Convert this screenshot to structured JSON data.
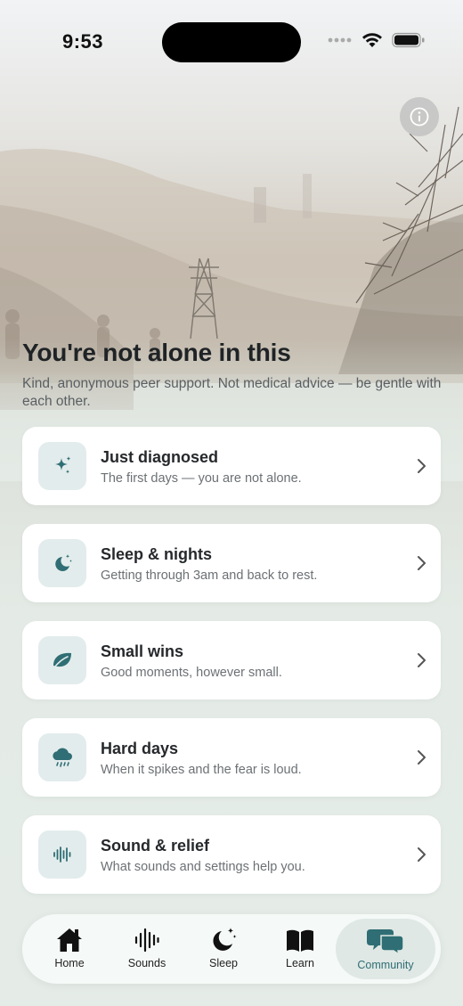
{
  "status_bar": {
    "time": "9:53"
  },
  "header": {
    "title": "You're not alone in this",
    "subtitle": "Kind, anonymous peer support. Not medical advice — be gentle with each other."
  },
  "topics": [
    {
      "title": "Just diagnosed",
      "subtitle": "The first days — you are not alone.",
      "icon": "sparkles-icon"
    },
    {
      "title": "Sleep & nights",
      "subtitle": "Getting through 3am and back to rest.",
      "icon": "moon-stars-icon"
    },
    {
      "title": "Small wins",
      "subtitle": "Good moments, however small.",
      "icon": "leaf-icon"
    },
    {
      "title": "Hard days",
      "subtitle": "When it spikes and the fear is loud.",
      "icon": "cloud-rain-icon"
    },
    {
      "title": "Sound & relief",
      "subtitle": "What sounds and settings help you.",
      "icon": "waveform-icon"
    }
  ],
  "tabbar": {
    "items": [
      {
        "label": "Home",
        "icon": "house-icon"
      },
      {
        "label": "Sounds",
        "icon": "waveform-icon"
      },
      {
        "label": "Sleep",
        "icon": "moon-stars-icon"
      },
      {
        "label": "Learn",
        "icon": "book-icon"
      },
      {
        "label": "Community",
        "icon": "chat-bubbles-icon"
      }
    ],
    "active": "Community"
  },
  "colors": {
    "accent": "#2f6e74",
    "icon_tile": "#e3ecec",
    "card": "#ffffff",
    "title": "#1f2326"
  }
}
